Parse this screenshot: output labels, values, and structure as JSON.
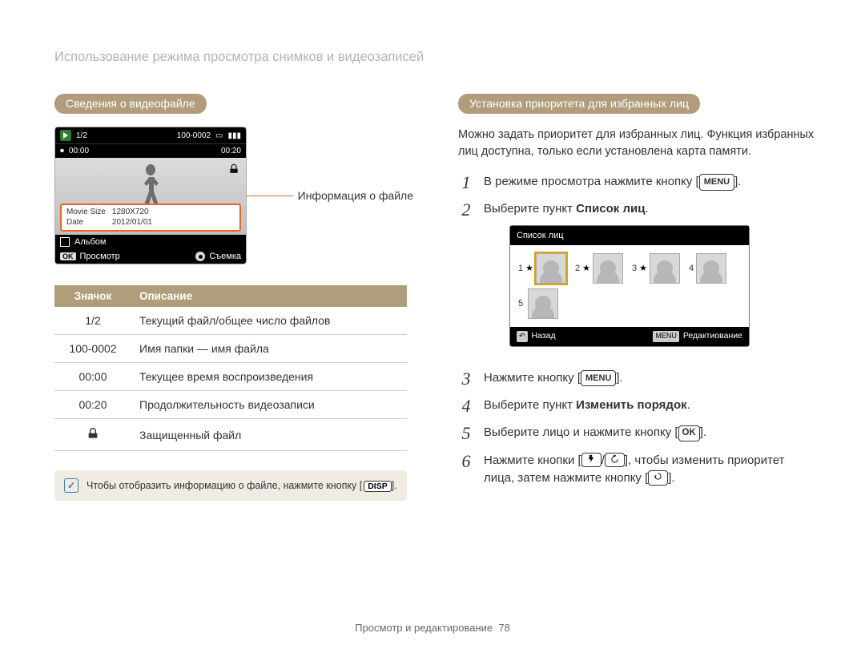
{
  "page_title": "Использование режима просмотра снимков и видеозаписей",
  "left": {
    "section_title": "Сведения о видеофайле",
    "video_mock": {
      "counter": "1/2",
      "elapsed": "00:00",
      "total": "00:20",
      "folder_file": "100-0002",
      "info_rows": {
        "movie_size_key": "Movie Size",
        "movie_size_val": "1280X720",
        "date_key": "Date",
        "date_val": "2012/01/01"
      },
      "album_label": "Альбом",
      "ok_label": "OK",
      "view_label": "Просмотр",
      "shoot_label": "Съемка"
    },
    "leader_label": "Информация о файле",
    "table": {
      "head_icon": "Значок",
      "head_desc": "Описание",
      "rows": [
        {
          "icon": "1/2",
          "desc": "Текущий файл/общее число файлов"
        },
        {
          "icon": "100-0002",
          "desc": "Имя папки — имя файла"
        },
        {
          "icon": "00:00",
          "desc": "Текущее время воспроизведения"
        },
        {
          "icon": "00:20",
          "desc": "Продолжительность видеозаписи"
        },
        {
          "icon": "lock",
          "desc": "Защищенный файл"
        }
      ]
    },
    "note_text": "Чтобы отобразить информацию о файле, нажмите кнопку [",
    "note_badge": "DISP",
    "note_text_after": "]."
  },
  "right": {
    "section_title": "Установка приоритета для избранных лиц",
    "intro": "Можно задать приоритет для избранных лиц. Функция избранных лиц доступна, только если установлена карта памяти.",
    "steps": {
      "s1_a": "В режиме просмотра нажмите кнопку [",
      "s1_badge": "MENU",
      "s1_b": "].",
      "s2_a": "Выберите пункт ",
      "s2_bold": "Список лиц",
      "s2_b": ".",
      "s3_a": "Нажмите кнопку [",
      "s3_badge": "MENU",
      "s3_b": "].",
      "s4_a": "Выберите пункт ",
      "s4_bold": "Изменить порядок",
      "s4_b": ".",
      "s5_a": "Выберите лицо и нажмите кнопку [",
      "s5_badge": "OK",
      "s5_b": "].",
      "s6_a": "Нажмите кнопки [",
      "s6_mid": "/",
      "s6_b": "], чтобы изменить приоритет лица, затем нажмите кнопку [",
      "s6_c": "]."
    },
    "facelist": {
      "title": "Список лиц",
      "nums": [
        "1",
        "2",
        "3",
        "4",
        "5"
      ],
      "back_label": "Назад",
      "menu_badge": "MENU",
      "edit_label": "Редактиование"
    }
  },
  "footer": {
    "text": "Просмотр и редактирование",
    "page": "78"
  }
}
